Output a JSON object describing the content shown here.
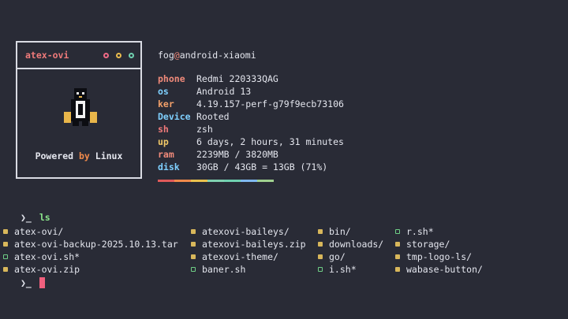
{
  "logo_box": {
    "title": "atex-ovi",
    "dots": [
      {
        "name": "close-dot",
        "color": "#ef6a86"
      },
      {
        "name": "minimize-dot",
        "color": "#e9bb4d"
      },
      {
        "name": "maximize-dot",
        "color": "#6fd0b0"
      }
    ],
    "powered_prefix": "Powered",
    "powered_by": "by",
    "powered_suffix": "Linux"
  },
  "sysinfo": {
    "user": "fog",
    "at": "@",
    "host": "android-xiaomi",
    "rows": [
      {
        "key": "phone",
        "value": "Redmi 220333QAG",
        "color": "#f08a7a"
      },
      {
        "key": "os",
        "value": "Android 13",
        "color": "#7fd0ff"
      },
      {
        "key": "ker",
        "value": "4.19.157-perf-g79f9ecb73106",
        "color": "#f2a06a"
      },
      {
        "key": "Device",
        "value": "Rooted",
        "color": "#7fd0ff"
      },
      {
        "key": "sh",
        "value": "zsh",
        "color": "#f07a7a"
      },
      {
        "key": "up",
        "value": "6 days, 2 hours, 31 minutes",
        "color": "#f0c868"
      },
      {
        "key": "ram",
        "value": "2239MB / 3820MB",
        "color": "#f08a7a"
      },
      {
        "key": "disk",
        "value": "30GB / 43GB = 13GB (71%)",
        "color": "#7fd0ff"
      }
    ],
    "colorbar": [
      "#e05a5a",
      "#f08a4b",
      "#e9c14d",
      "#7fd0b0",
      "#6fd0b0",
      "#7fb8f0",
      "#9fd08f"
    ]
  },
  "terminal": {
    "prompt_symbol": "❯_",
    "command": "ls",
    "columns": [
      [
        {
          "name": "atex-ovi/",
          "type": "folder"
        },
        {
          "name": "atex-ovi-backup-2025.10.13.tar",
          "type": "folder"
        },
        {
          "name": "atex-ovi.sh*",
          "type": "exe"
        },
        {
          "name": "atex-ovi.zip",
          "type": "folder"
        }
      ],
      [
        {
          "name": "atexovi-baileys/",
          "type": "folder"
        },
        {
          "name": "atexovi-baileys.zip",
          "type": "folder"
        },
        {
          "name": "atexovi-theme/",
          "type": "folder"
        },
        {
          "name": "baner.sh",
          "type": "exe"
        }
      ],
      [
        {
          "name": "bin/",
          "type": "folder"
        },
        {
          "name": "downloads/",
          "type": "folder"
        },
        {
          "name": "go/",
          "type": "folder"
        },
        {
          "name": "i.sh*",
          "type": "exe"
        }
      ],
      [
        {
          "name": "r.sh*",
          "type": "exe"
        },
        {
          "name": "storage/",
          "type": "folder"
        },
        {
          "name": "tmp-logo-ls/",
          "type": "folder"
        },
        {
          "name": "wabase-button/",
          "type": "folder"
        }
      ]
    ]
  }
}
